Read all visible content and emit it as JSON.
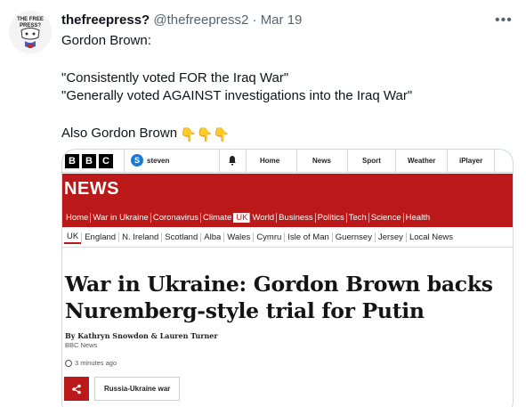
{
  "tweet": {
    "avatar_text": [
      "THE FREE",
      "PRESS?"
    ],
    "display_name": "thefreepress?",
    "handle": "@thefreepress2",
    "separator": "·",
    "date": "Mar 19",
    "more_label": "•••",
    "lines": [
      "Gordon Brown:",
      "\"Consistently voted FOR the Iraq War\"",
      "\"Generally voted AGAINST investigations into the Iraq War\"",
      "Also Gordon Brown"
    ],
    "emoji": "👇👇👇"
  },
  "bbc": {
    "logo_letters": [
      "B",
      "B",
      "C"
    ],
    "user_initial": "S",
    "user_name": "steven",
    "top_nav": [
      "Home",
      "News",
      "Sport",
      "Weather",
      "iPlayer"
    ],
    "section_title": "NEWS",
    "news_nav": [
      "Home",
      "War in Ukraine",
      "Coronavirus",
      "Climate",
      "UK",
      "World",
      "Business",
      "Politics",
      "Tech",
      "Science",
      "Health"
    ],
    "news_nav_active": "UK",
    "sub_nav": [
      "UK",
      "England",
      "N. Ireland",
      "Scotland",
      "Alba",
      "Wales",
      "Cymru",
      "Isle of Man",
      "Guernsey",
      "Jersey",
      "Local News"
    ],
    "sub_nav_active": "UK",
    "headline": "War in Ukraine: Gordon Brown backs Nuremberg-style trial for Putin",
    "byline": "By Kathryn Snowdon & Lauren Turner",
    "byline_org": "BBC News",
    "timestamp": "3 minutes ago",
    "tag": "Russia-Ukraine war",
    "colors": {
      "brand_red": "#bb1919",
      "signin_blue": "#1a7ad6"
    }
  }
}
